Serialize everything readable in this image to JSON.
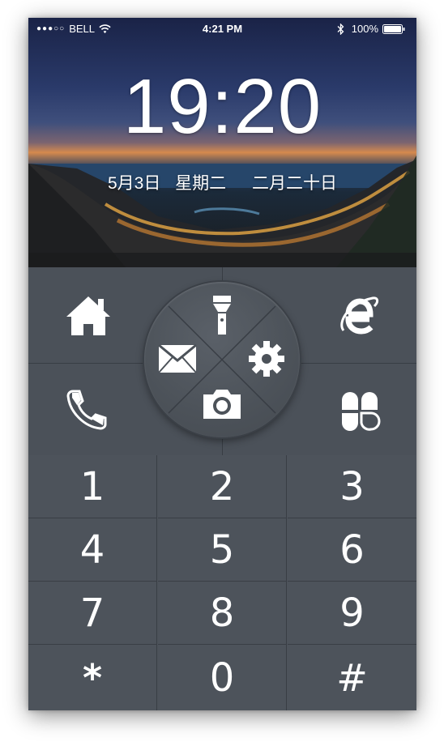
{
  "status_bar": {
    "signal": "●●●○○",
    "carrier": "BELL",
    "time": "4:21 PM",
    "battery": "100%",
    "wifi_icon": "wifi-icon",
    "bluetooth_icon": "bluetooth-icon",
    "battery_icon": "battery-full-icon"
  },
  "lock_screen": {
    "clock": "19:20",
    "date": "5月3日",
    "weekday": "星期二",
    "lunar_date": "二月二十日"
  },
  "shortcuts": {
    "home_icon": "home-icon",
    "browser_icon": "browser-e-icon",
    "phone_icon": "phone-handset-icon",
    "apps_icon": "clover-apps-icon"
  },
  "wheel": {
    "top": "flashlight-icon",
    "left": "mail-icon",
    "right": "settings-gear-icon",
    "bottom": "camera-icon"
  },
  "keypad": {
    "keys": [
      "1",
      "2",
      "3",
      "4",
      "5",
      "6",
      "7",
      "8",
      "9",
      "*",
      "0",
      "#"
    ]
  },
  "colors": {
    "panel": "#4b5159",
    "divider": "#383d44",
    "text": "#ffffff"
  }
}
